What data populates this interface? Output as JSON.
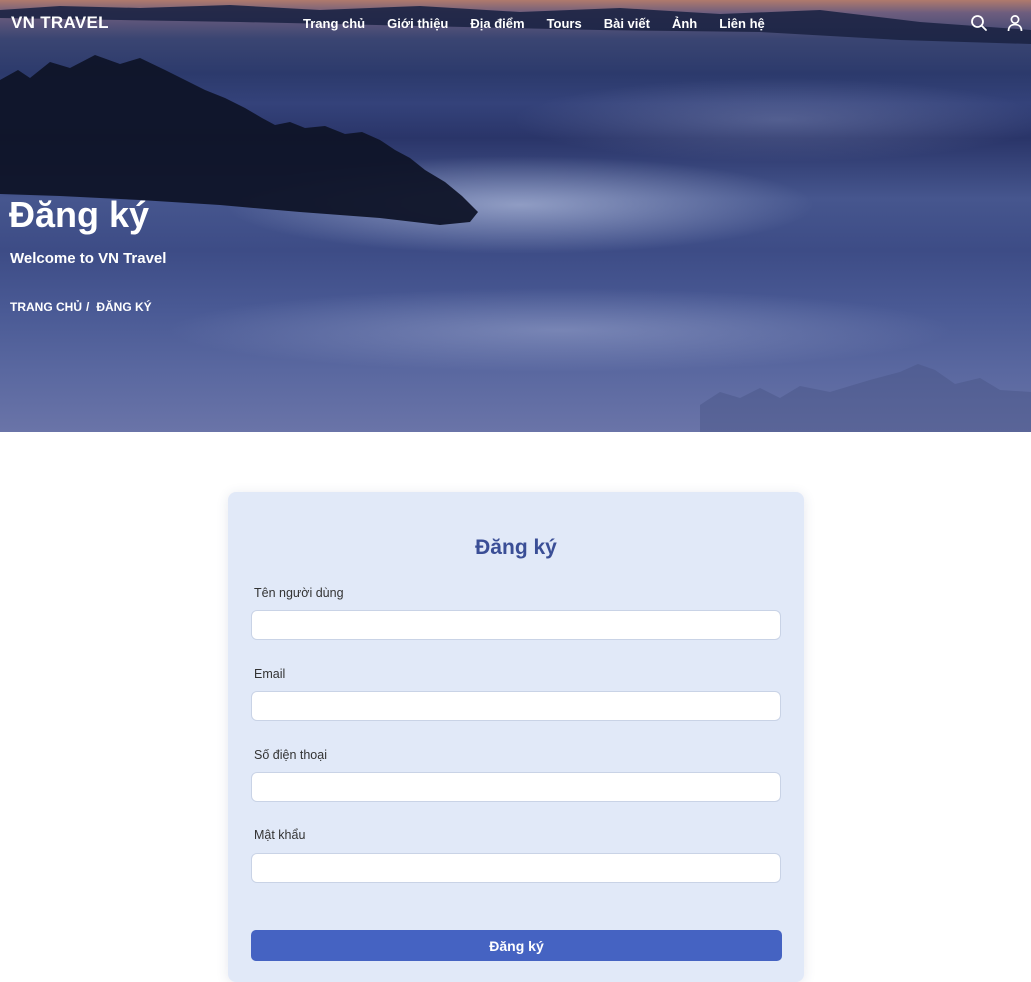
{
  "brand": {
    "logo": "VN TRAVEL"
  },
  "nav": {
    "items": [
      {
        "label": "Trang chủ"
      },
      {
        "label": "Giới thiệu"
      },
      {
        "label": "Địa điểm"
      },
      {
        "label": "Tours"
      },
      {
        "label": "Bài viết"
      },
      {
        "label": "Ảnh"
      },
      {
        "label": "Liên hệ"
      }
    ],
    "icons": [
      "search-icon",
      "user-icon"
    ]
  },
  "hero": {
    "title": "Đăng ký",
    "subtitle": "Welcome to VN Travel",
    "breadcrumb": {
      "home": "TRANG CHỦ",
      "separator": "/",
      "current": "ĐĂNG KÝ"
    }
  },
  "form": {
    "title": "Đăng ký",
    "fields": {
      "username": {
        "label": "Tên người dùng",
        "value": ""
      },
      "email": {
        "label": "Email",
        "value": ""
      },
      "phone": {
        "label": "Số điện thoại",
        "value": ""
      },
      "password": {
        "label": "Mật khẩu",
        "value": ""
      }
    },
    "submit_label": "Đăng ký"
  },
  "colors": {
    "accent": "#4563c2",
    "form_title": "#3a4e96",
    "card_background": "#e1e9f8"
  }
}
